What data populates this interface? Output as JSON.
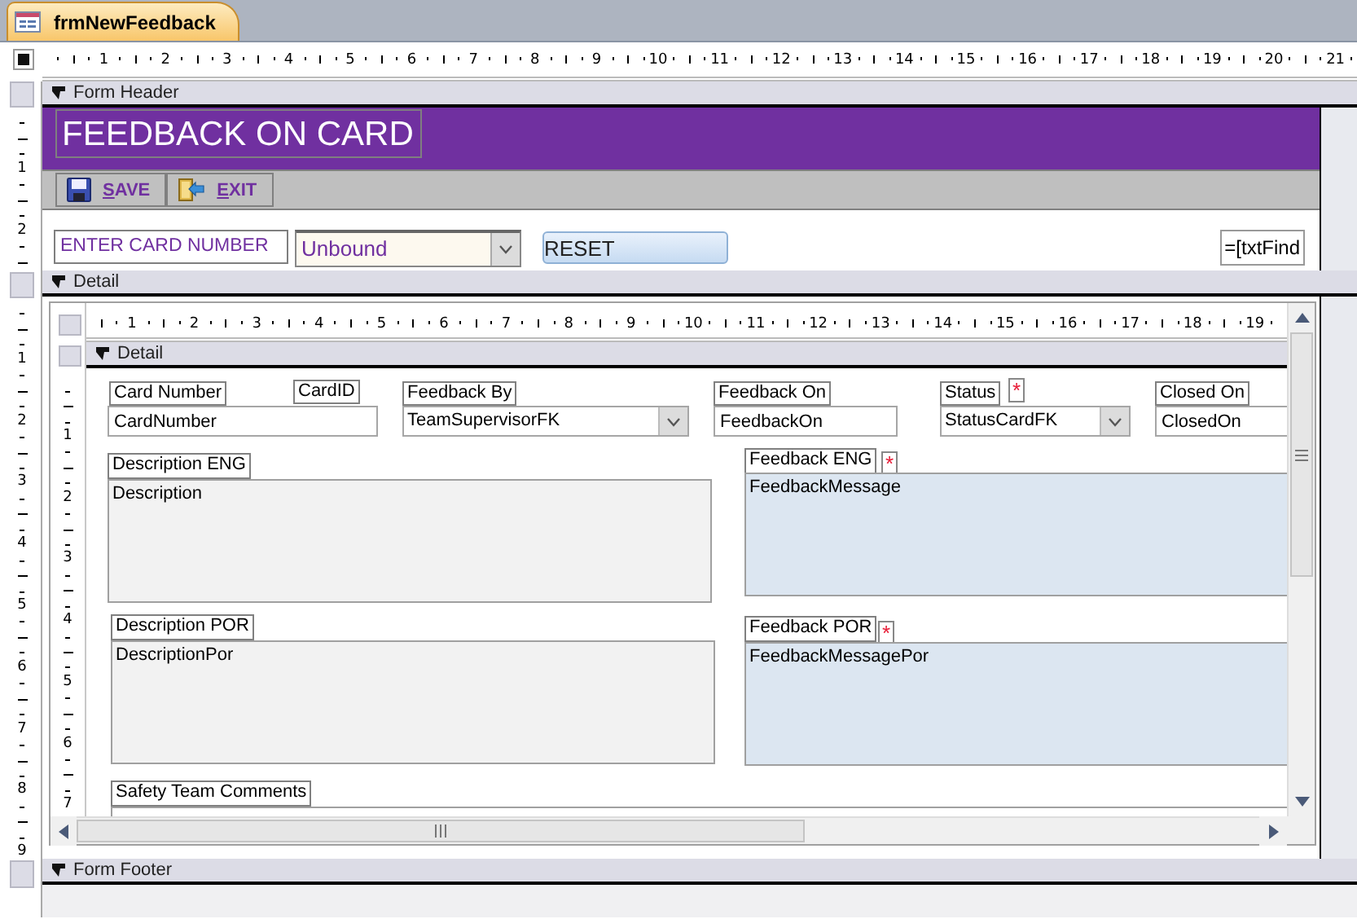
{
  "document_tab": {
    "title": "frmNewFeedback",
    "selected": true
  },
  "top_ruler": [
    "1",
    "2",
    "3",
    "4",
    "5",
    "6",
    "7",
    "8",
    "9",
    "10",
    "11",
    "12",
    "13",
    "14",
    "15",
    "16",
    "17",
    "18",
    "19",
    "20",
    "21"
  ],
  "left_ruler": {
    "header": [
      "1",
      "2"
    ],
    "detail": [
      "1",
      "2",
      "3",
      "4",
      "5",
      "6",
      "7",
      "8",
      "9"
    ]
  },
  "form_header": {
    "section_title": "Form Header",
    "title": "FEEDBACK ON CARD",
    "buttons": [
      {
        "kind": "save",
        "label": "SAVE"
      },
      {
        "kind": "exit",
        "label": "EXIT"
      }
    ],
    "card_number_field": {
      "value": "ENTER CARD NUMBER"
    },
    "lookup_combo": {
      "value": "Unbound"
    },
    "reset_button": {
      "label": "RESET"
    },
    "find_expression_field": {
      "value": "=[txtFind"
    }
  },
  "detail": {
    "section_title": "Detail",
    "subform": {
      "top_ruler": [
        "1",
        "2",
        "3",
        "4",
        "5",
        "6",
        "7",
        "8",
        "9",
        "10",
        "11",
        "12",
        "13",
        "14",
        "15",
        "16",
        "17",
        "18",
        "19"
      ],
      "left_ruler": [
        "1",
        "2",
        "3",
        "4",
        "5",
        "6",
        "7"
      ],
      "section_title": "Detail",
      "controls": [
        {
          "kind": "label",
          "text": "Card Number"
        },
        {
          "kind": "label",
          "text": "CardID"
        },
        {
          "kind": "textbox",
          "value": "CardNumber"
        },
        {
          "kind": "label",
          "text": "Feedback By"
        },
        {
          "kind": "combo",
          "value": "TeamSupervisorFK"
        },
        {
          "kind": "label",
          "text": "Feedback On"
        },
        {
          "kind": "textbox",
          "value": "FeedbackOn"
        },
        {
          "kind": "label",
          "text": "Status"
        },
        {
          "kind": "required_mark",
          "text": "*"
        },
        {
          "kind": "combo",
          "value": "StatusCardFK"
        },
        {
          "kind": "label",
          "text": "Closed On"
        },
        {
          "kind": "textbox",
          "value": "ClosedOn"
        },
        {
          "kind": "label",
          "text": "Description ENG"
        },
        {
          "kind": "memo",
          "value": "Description",
          "color": "#f2f2f2"
        },
        {
          "kind": "label",
          "text": "Feedback ENG"
        },
        {
          "kind": "required_mark",
          "text": "*"
        },
        {
          "kind": "memo",
          "value": "FeedbackMessage",
          "color": "#dce6f1"
        },
        {
          "kind": "label",
          "text": "Description POR"
        },
        {
          "kind": "memo",
          "value": "DescriptionPor",
          "color": "#f2f2f2"
        },
        {
          "kind": "label",
          "text": "Feedback POR"
        },
        {
          "kind": "required_mark",
          "text": "*"
        },
        {
          "kind": "memo",
          "value": "FeedbackMessagePor",
          "color": "#dce6f1"
        },
        {
          "kind": "label",
          "text": "Safety Team Comments"
        },
        {
          "kind": "memo",
          "color": "#ffffff"
        }
      ]
    }
  },
  "form_footer": {
    "section_title": "Form Footer"
  }
}
